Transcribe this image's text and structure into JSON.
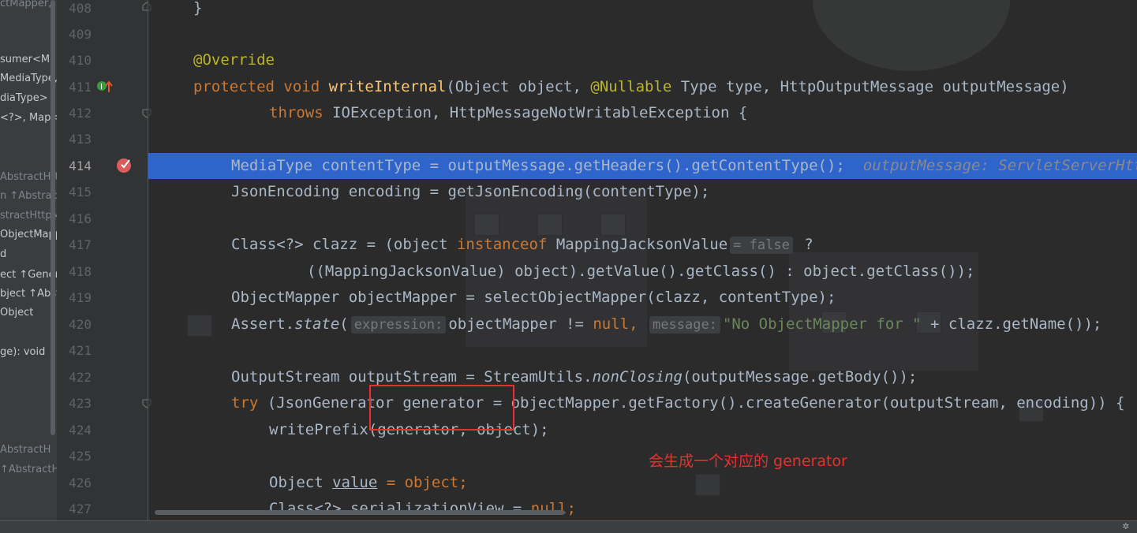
{
  "structure_items": [
    "ctMapper,",
    "sumer<Ma",
    "MediaType,",
    "diaType>",
    "<?>, Map<",
    "AbstractHttpM",
    "n ↑Abstrac",
    "stractHttpM",
    "ObjectMapp",
    "d",
    "ect ↑Gener",
    "bject ↑Abst",
    "Object",
    "ge): void ↑A",
    "AbstractH",
    "↑AbstractH"
  ],
  "line_numbers": [
    "408",
    "409",
    "410",
    "411",
    "412",
    "413",
    "414",
    "415",
    "416",
    "417",
    "418",
    "419",
    "420",
    "421",
    "422",
    "423",
    "424",
    "425",
    "426",
    "427"
  ],
  "code": {
    "l408": "}",
    "l410": "@Override",
    "l411_kw1": "protected",
    "l411_kw2": "void",
    "l411_fn": "writeInternal",
    "l411_a": "(Object object, ",
    "l411_an": "@Nullable",
    "l411_b": " Type type, HttpOutputMessage outputMessage)",
    "l412_kw": "throws",
    "l412_rest": " IOException, HttpMessageNotWritableException {",
    "l414": "MediaType contentType = outputMessage.getHeaders().getContentType();",
    "l414_inline": "outputMessage: ServletServerHttpResponse",
    "l415": "JsonEncoding encoding = getJsonEncoding(contentType);",
    "l417_a": "Class<?> clazz = (object ",
    "l417_kw": "instanceof",
    "l417_b": " MappingJacksonValue",
    "l417_hint": "= false",
    "l417_c": "?",
    "l418": "((MappingJacksonValue) object).getValue().getClass() : object.getClass());",
    "l419": "ObjectMapper objectMapper = selectObjectMapper(clazz, contentType);",
    "l420_a": "Assert.",
    "l420_it": "state",
    "l420_b": "(",
    "l420_hint1": "expression:",
    "l420_c": "objectMapper != ",
    "l420_null": "null",
    "l420_comma": ",",
    "l420_hint2": "message:",
    "l420_str": "\"No ObjectMapper for \"",
    "l420_d": " + clazz.getName());",
    "l422_a": "OutputStream outputStream = StreamUtils.",
    "l422_it": "nonClosing",
    "l422_b": "(outputMessage.getBody());",
    "l423_kw": "try",
    "l423_rest": " (JsonGenerator generator = objectMapper.getFactory().createGenerator(outputStream, encoding)) {",
    "l424": "writePrefix(generator, object);",
    "l426_a": "Object ",
    "l426_ul": "value",
    "l426_b": " = object;",
    "l427_a": "Class<?> ",
    "l427_ul": "serializationView",
    "l427_b": " = ",
    "l427_null": "null",
    "l427_c": ";"
  },
  "annotation_note": "会生成一个对应的 generator",
  "colors": {
    "keyword": "#cc7832",
    "annotation": "#bbb529",
    "method": "#ffc66d",
    "string": "#6a8759",
    "highlight_line": "#2f65ca",
    "red_annotation": "#e83030"
  }
}
